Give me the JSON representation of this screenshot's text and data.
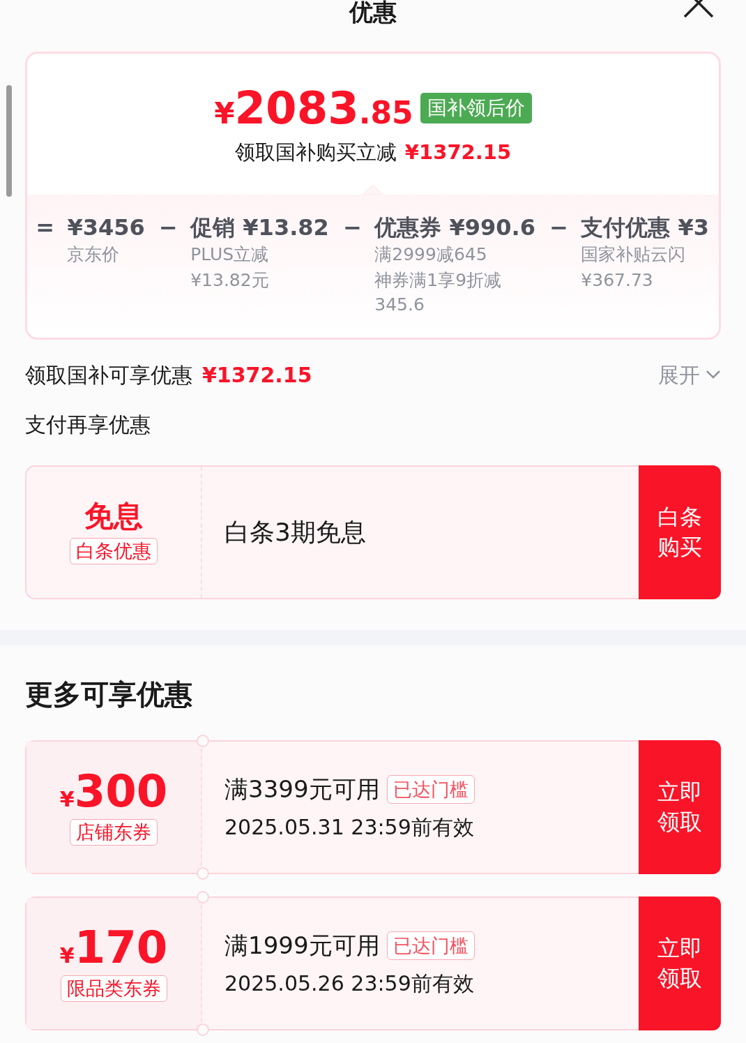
{
  "header": {
    "title": "优惠"
  },
  "summary": {
    "price_symbol": "¥",
    "price_integer": "2083",
    "price_decimal": ".85",
    "tag": "国补领后价",
    "subtitle": "领取国补购买立减",
    "subtitle_amount": "¥1372.15"
  },
  "breakdown": [
    {
      "operator": "=",
      "title": "¥3456",
      "lines": [
        "京东价"
      ]
    },
    {
      "operator": "−",
      "title": "促销 ¥13.82",
      "lines": [
        "PLUS立减",
        "¥13.82元"
      ]
    },
    {
      "operator": "−",
      "title": "优惠券 ¥990.6",
      "lines": [
        "满2999减645",
        "神券满1享9折减 345.6"
      ]
    },
    {
      "operator": "−",
      "title": "支付优惠 ¥3",
      "lines": [
        "国家补贴云闪",
        "¥367.73"
      ]
    }
  ],
  "subsidy_row": {
    "label": "领取国补可享优惠",
    "amount": "¥1372.15",
    "toggle": "展开",
    "expanded": false
  },
  "pay_section": {
    "title": "支付再享优惠",
    "offers": [
      {
        "kind": "interest_free",
        "headline": "免息",
        "tag": "白条优惠",
        "description": "白条3期免息",
        "action": "白条购买"
      }
    ]
  },
  "more_section": {
    "title": "更多可享优惠",
    "offers": [
      {
        "kind": "coupon",
        "symbol": "¥",
        "amount": "300",
        "tag": "店铺东券",
        "condition": "满3399元可用",
        "badge": "已达门槛",
        "validity": "2025.05.31 23:59前有效",
        "action": "立即领取"
      },
      {
        "kind": "coupon",
        "symbol": "¥",
        "amount": "170",
        "tag": "限品类东券",
        "condition": "满1999元可用",
        "badge": "已达门槛",
        "validity": "2025.05.26 23:59前有效",
        "action": "立即领取"
      }
    ]
  }
}
